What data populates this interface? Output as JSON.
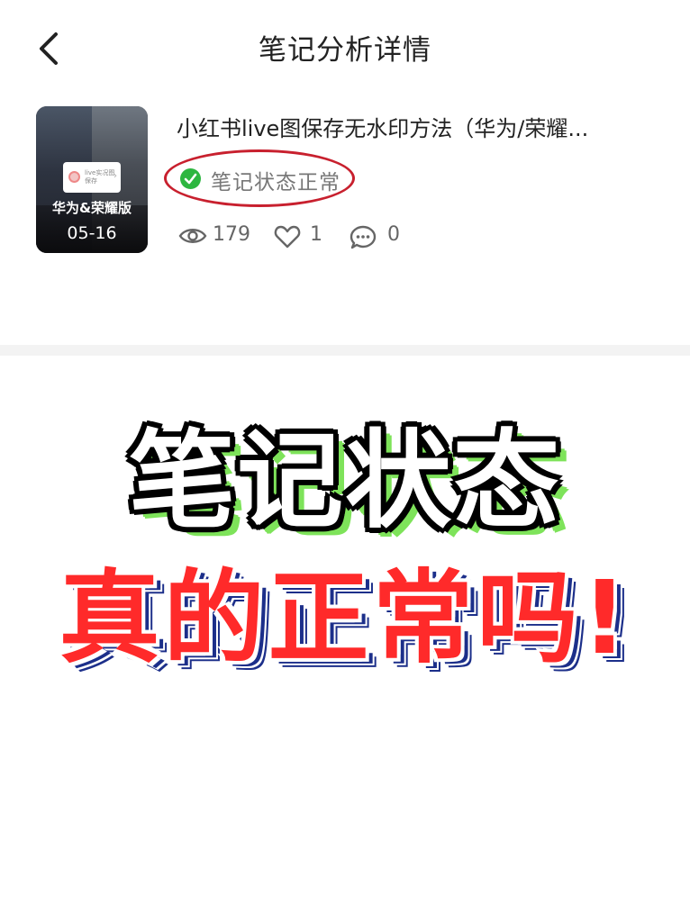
{
  "header": {
    "title": "笔记分析详情"
  },
  "note": {
    "title": "小红书live图保存无水印方法（华为/荣耀...",
    "thumbnail": {
      "brand_text": "华为&荣耀版",
      "date": "05-16",
      "pill_text": "live实况图保存"
    },
    "status": {
      "text": "笔记状态正常",
      "color": "#2db640",
      "highlight_color": "#c8202e"
    },
    "stats": {
      "views": "179",
      "likes": "1",
      "comments": "0"
    }
  },
  "overlay": {
    "line1": "笔记状态",
    "line2": "真的正常吗!",
    "line1_accent": "#7ee35a",
    "line2_color": "#ff2a2a",
    "line2_shadow": "#1c2f8a"
  }
}
